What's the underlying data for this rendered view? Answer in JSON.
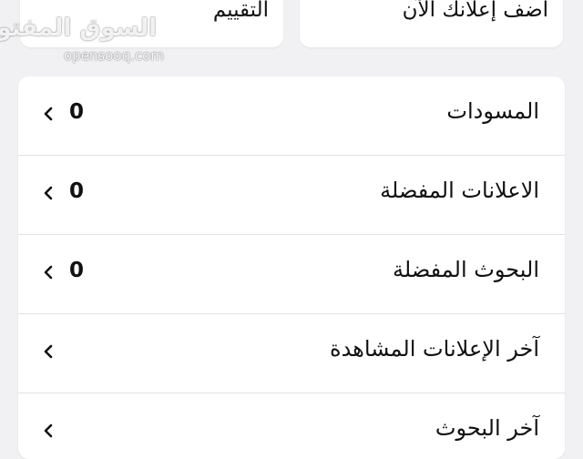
{
  "top_cards": {
    "rating_label": "التقييم",
    "post_ad_label": "اضف إعلانك الآن"
  },
  "watermark": {
    "arabic": "السوق المفتوح",
    "latin": "opensooq.com"
  },
  "menu": {
    "items": [
      {
        "label": "المسودات",
        "count": "0",
        "icon": "chevron-left-icon"
      },
      {
        "label": "الاعلانات المفضلة",
        "count": "0",
        "icon": "chevron-left-icon"
      },
      {
        "label": "البحوث المفضلة",
        "count": "0",
        "icon": "chevron-left-icon"
      },
      {
        "label": "آخر الإعلانات المشاهدة",
        "icon": "chevron-left-icon"
      },
      {
        "label": "آخر البحوث",
        "icon": "chevron-left-icon"
      }
    ]
  }
}
